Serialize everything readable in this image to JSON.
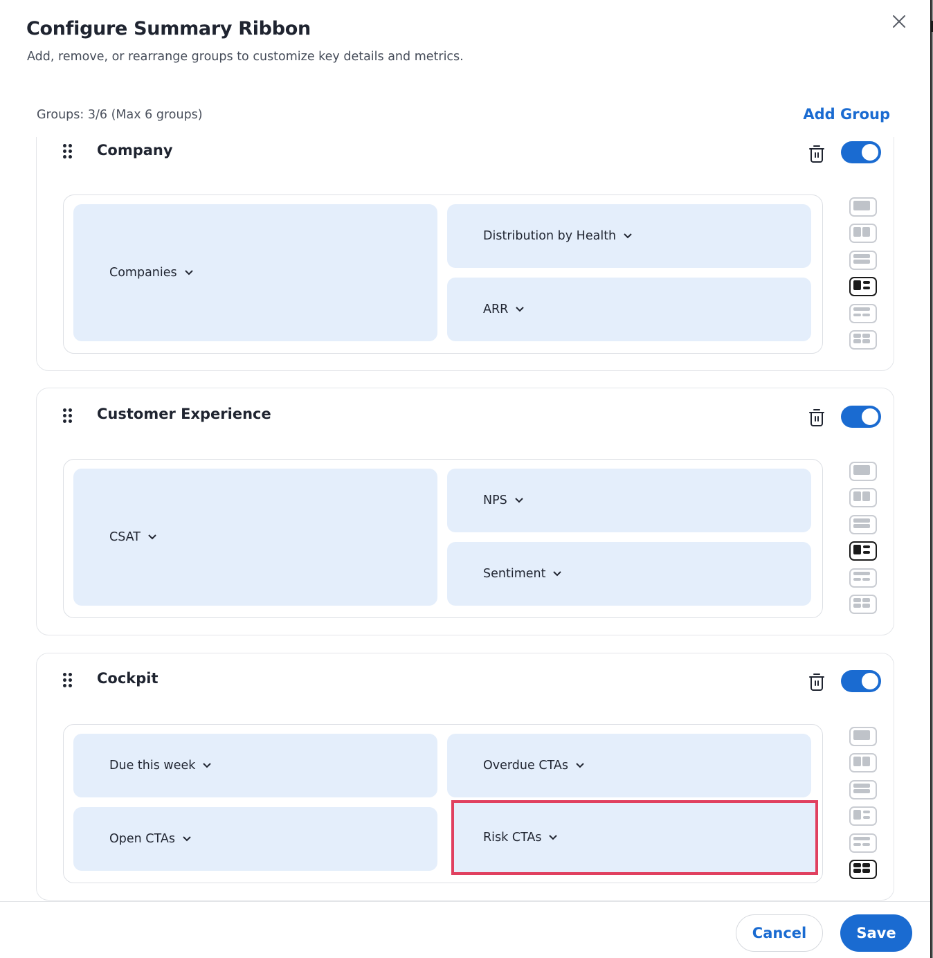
{
  "dialog": {
    "title": "Configure Summary Ribbon",
    "subtitle": "Add, remove, or rearrange groups to customize key details and metrics.",
    "close_icon": "close-icon"
  },
  "toolbar": {
    "groups_count": "Groups: 3/6 (Max 6 groups)",
    "add_group_label": "Add Group"
  },
  "colors": {
    "accent": "#1a6bd1",
    "tile_bg": "#e4eefb",
    "highlight": "#e0405f"
  },
  "layout_options": [
    "single",
    "two-columns",
    "two-rows",
    "one-left-two-right",
    "one-top-two-bottom",
    "grid-2x2"
  ],
  "groups": [
    {
      "title": "Company",
      "enabled": true,
      "selected_layout": "one-left-two-right",
      "tiles": [
        {
          "label": "Companies"
        },
        {
          "label": "Distribution by Health"
        },
        {
          "label": "ARR"
        }
      ]
    },
    {
      "title": "Customer Experience",
      "enabled": true,
      "selected_layout": "one-left-two-right",
      "tiles": [
        {
          "label": "CSAT"
        },
        {
          "label": "NPS"
        },
        {
          "label": "Sentiment"
        }
      ]
    },
    {
      "title": "Cockpit",
      "enabled": true,
      "selected_layout": "grid-2x2",
      "tiles": [
        {
          "label": "Due this week"
        },
        {
          "label": "Overdue CTAs"
        },
        {
          "label": "Open CTAs"
        },
        {
          "label": "Risk CTAs",
          "highlighted": true
        }
      ]
    }
  ],
  "footer": {
    "cancel_label": "Cancel",
    "save_label": "Save"
  }
}
